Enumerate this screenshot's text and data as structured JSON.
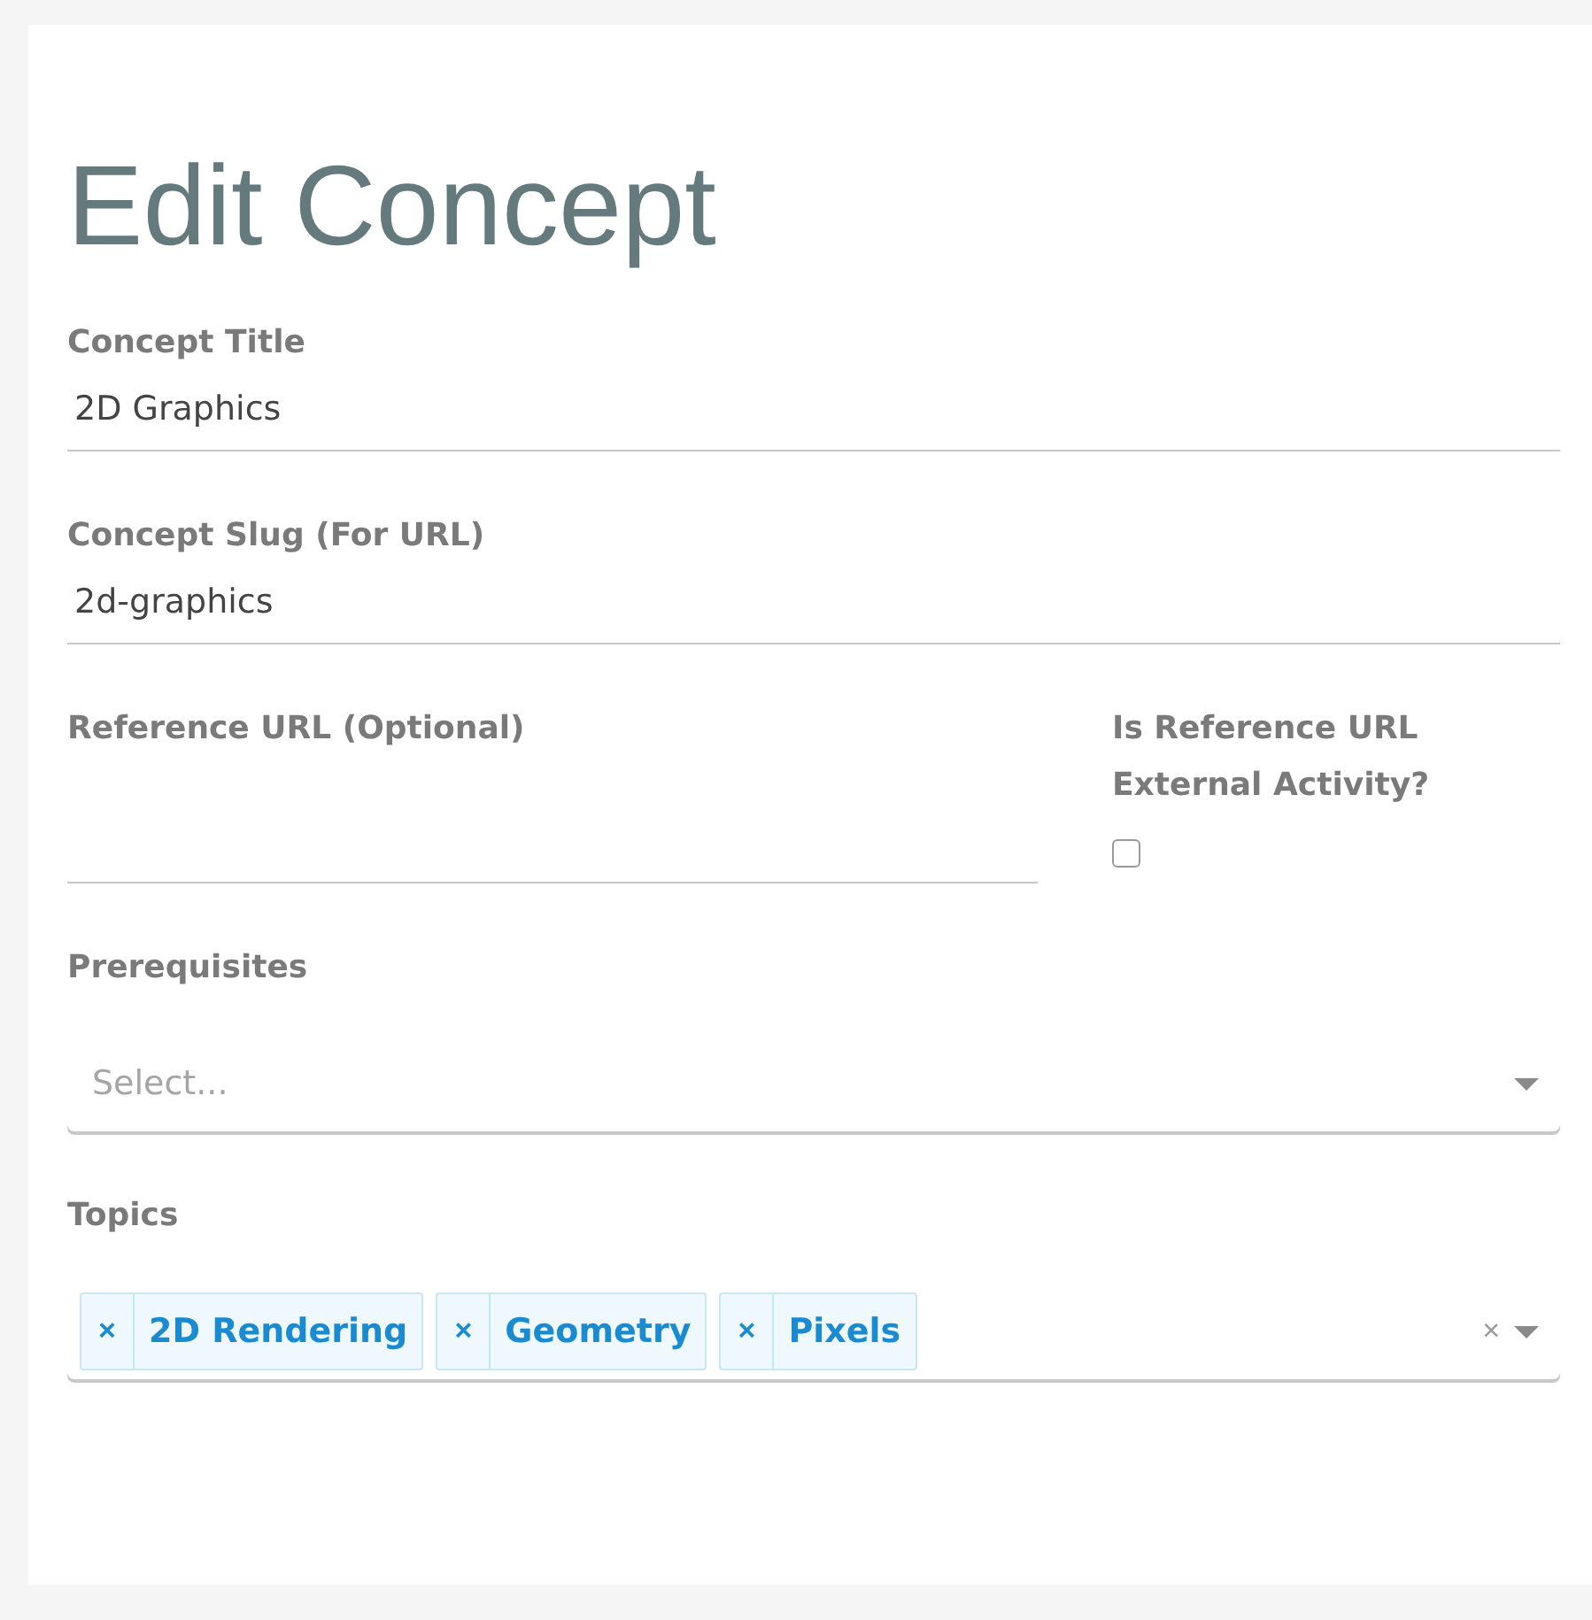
{
  "title": "Edit Concept",
  "concept_title": {
    "label": "Concept Title",
    "value": "2D Graphics"
  },
  "concept_slug": {
    "label": "Concept Slug (For URL)",
    "value": "2d-graphics"
  },
  "reference_url": {
    "label": "Reference URL (Optional)"
  },
  "external_activity": {
    "label": "Is Reference URL External Activity?",
    "checked": false
  },
  "prerequisites": {
    "label": "Prerequisites",
    "placeholder": "Select..."
  },
  "topics": {
    "label": "Topics",
    "clear": "×",
    "tags": [
      {
        "remove": "×",
        "label": "2D Rendering"
      },
      {
        "remove": "×",
        "label": "Geometry"
      },
      {
        "remove": "×",
        "label": "Pixels"
      }
    ]
  }
}
